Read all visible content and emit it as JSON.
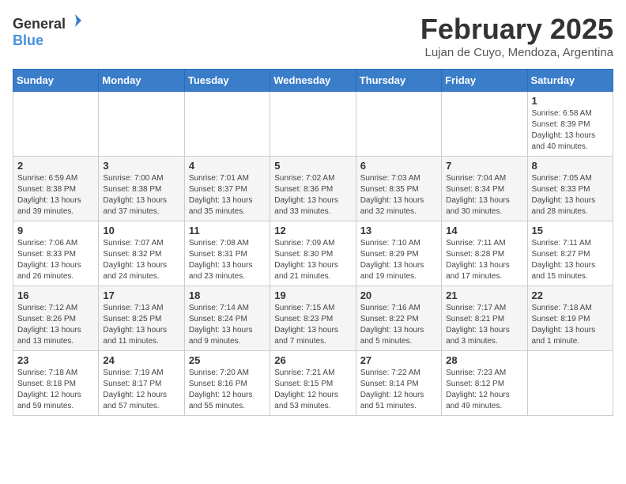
{
  "header": {
    "logo_general": "General",
    "logo_blue": "Blue",
    "month_title": "February 2025",
    "location": "Lujan de Cuyo, Mendoza, Argentina"
  },
  "days_of_week": [
    "Sunday",
    "Monday",
    "Tuesday",
    "Wednesday",
    "Thursday",
    "Friday",
    "Saturday"
  ],
  "weeks": [
    [
      {
        "day": "",
        "info": ""
      },
      {
        "day": "",
        "info": ""
      },
      {
        "day": "",
        "info": ""
      },
      {
        "day": "",
        "info": ""
      },
      {
        "day": "",
        "info": ""
      },
      {
        "day": "",
        "info": ""
      },
      {
        "day": "1",
        "info": "Sunrise: 6:58 AM\nSunset: 8:39 PM\nDaylight: 13 hours\nand 40 minutes."
      }
    ],
    [
      {
        "day": "2",
        "info": "Sunrise: 6:59 AM\nSunset: 8:38 PM\nDaylight: 13 hours\nand 39 minutes."
      },
      {
        "day": "3",
        "info": "Sunrise: 7:00 AM\nSunset: 8:38 PM\nDaylight: 13 hours\nand 37 minutes."
      },
      {
        "day": "4",
        "info": "Sunrise: 7:01 AM\nSunset: 8:37 PM\nDaylight: 13 hours\nand 35 minutes."
      },
      {
        "day": "5",
        "info": "Sunrise: 7:02 AM\nSunset: 8:36 PM\nDaylight: 13 hours\nand 33 minutes."
      },
      {
        "day": "6",
        "info": "Sunrise: 7:03 AM\nSunset: 8:35 PM\nDaylight: 13 hours\nand 32 minutes."
      },
      {
        "day": "7",
        "info": "Sunrise: 7:04 AM\nSunset: 8:34 PM\nDaylight: 13 hours\nand 30 minutes."
      },
      {
        "day": "8",
        "info": "Sunrise: 7:05 AM\nSunset: 8:33 PM\nDaylight: 13 hours\nand 28 minutes."
      }
    ],
    [
      {
        "day": "9",
        "info": "Sunrise: 7:06 AM\nSunset: 8:33 PM\nDaylight: 13 hours\nand 26 minutes."
      },
      {
        "day": "10",
        "info": "Sunrise: 7:07 AM\nSunset: 8:32 PM\nDaylight: 13 hours\nand 24 minutes."
      },
      {
        "day": "11",
        "info": "Sunrise: 7:08 AM\nSunset: 8:31 PM\nDaylight: 13 hours\nand 23 minutes."
      },
      {
        "day": "12",
        "info": "Sunrise: 7:09 AM\nSunset: 8:30 PM\nDaylight: 13 hours\nand 21 minutes."
      },
      {
        "day": "13",
        "info": "Sunrise: 7:10 AM\nSunset: 8:29 PM\nDaylight: 13 hours\nand 19 minutes."
      },
      {
        "day": "14",
        "info": "Sunrise: 7:11 AM\nSunset: 8:28 PM\nDaylight: 13 hours\nand 17 minutes."
      },
      {
        "day": "15",
        "info": "Sunrise: 7:11 AM\nSunset: 8:27 PM\nDaylight: 13 hours\nand 15 minutes."
      }
    ],
    [
      {
        "day": "16",
        "info": "Sunrise: 7:12 AM\nSunset: 8:26 PM\nDaylight: 13 hours\nand 13 minutes."
      },
      {
        "day": "17",
        "info": "Sunrise: 7:13 AM\nSunset: 8:25 PM\nDaylight: 13 hours\nand 11 minutes."
      },
      {
        "day": "18",
        "info": "Sunrise: 7:14 AM\nSunset: 8:24 PM\nDaylight: 13 hours\nand 9 minutes."
      },
      {
        "day": "19",
        "info": "Sunrise: 7:15 AM\nSunset: 8:23 PM\nDaylight: 13 hours\nand 7 minutes."
      },
      {
        "day": "20",
        "info": "Sunrise: 7:16 AM\nSunset: 8:22 PM\nDaylight: 13 hours\nand 5 minutes."
      },
      {
        "day": "21",
        "info": "Sunrise: 7:17 AM\nSunset: 8:21 PM\nDaylight: 13 hours\nand 3 minutes."
      },
      {
        "day": "22",
        "info": "Sunrise: 7:18 AM\nSunset: 8:19 PM\nDaylight: 13 hours\nand 1 minute."
      }
    ],
    [
      {
        "day": "23",
        "info": "Sunrise: 7:18 AM\nSunset: 8:18 PM\nDaylight: 12 hours\nand 59 minutes."
      },
      {
        "day": "24",
        "info": "Sunrise: 7:19 AM\nSunset: 8:17 PM\nDaylight: 12 hours\nand 57 minutes."
      },
      {
        "day": "25",
        "info": "Sunrise: 7:20 AM\nSunset: 8:16 PM\nDaylight: 12 hours\nand 55 minutes."
      },
      {
        "day": "26",
        "info": "Sunrise: 7:21 AM\nSunset: 8:15 PM\nDaylight: 12 hours\nand 53 minutes."
      },
      {
        "day": "27",
        "info": "Sunrise: 7:22 AM\nSunset: 8:14 PM\nDaylight: 12 hours\nand 51 minutes."
      },
      {
        "day": "28",
        "info": "Sunrise: 7:23 AM\nSunset: 8:12 PM\nDaylight: 12 hours\nand 49 minutes."
      },
      {
        "day": "",
        "info": ""
      }
    ]
  ]
}
